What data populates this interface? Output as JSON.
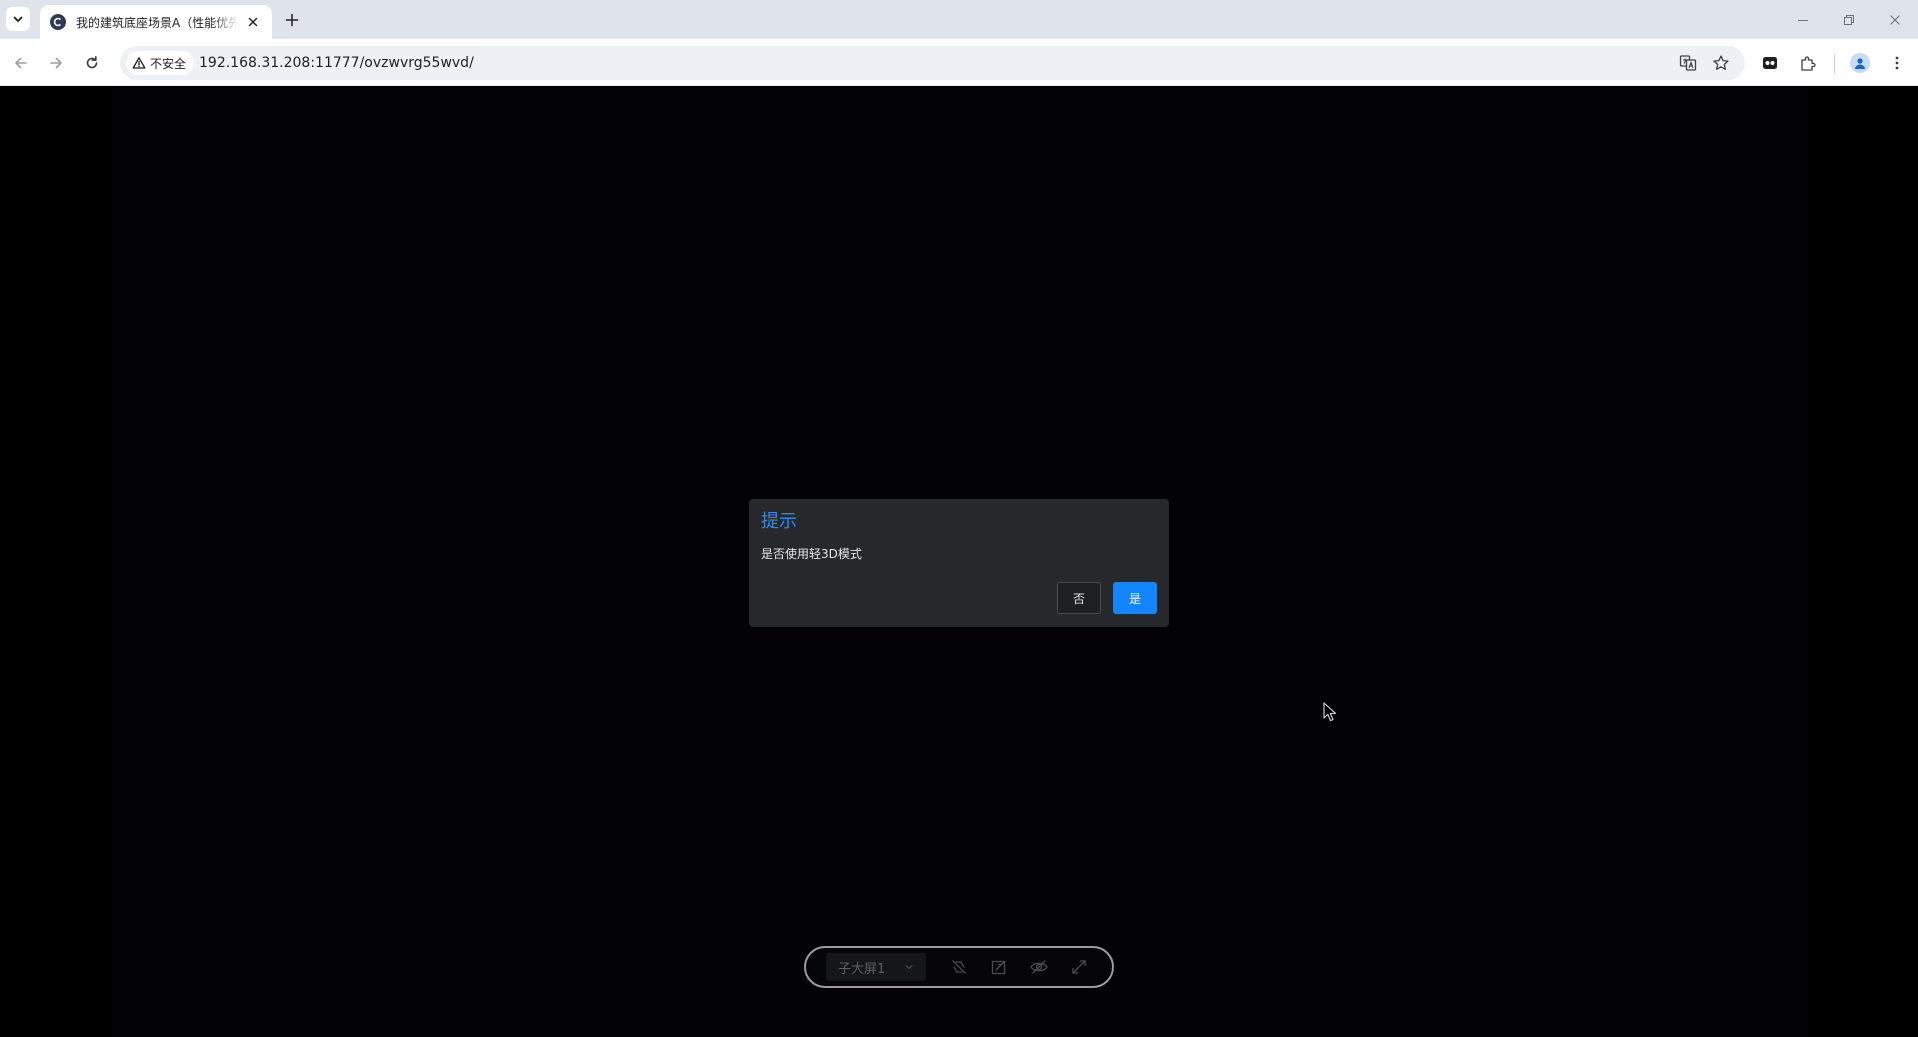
{
  "browser": {
    "tab": {
      "title": "我的建筑底座场景A（性能优先）"
    },
    "omnibox": {
      "security_label": "不安全",
      "url": "192.168.31.208:11777/ovzwvrg55wvd/"
    }
  },
  "modal": {
    "title": "提示",
    "message": "是否使用轻3D模式",
    "cancel_label": "否",
    "confirm_label": "是"
  },
  "bottom_bar": {
    "screen_select_value": "子大屏1"
  },
  "colors": {
    "modal_title": "#2d8cf0",
    "primary_button": "#1385ff",
    "modal_bg": "#27282b",
    "stage_bg": "#030305"
  }
}
